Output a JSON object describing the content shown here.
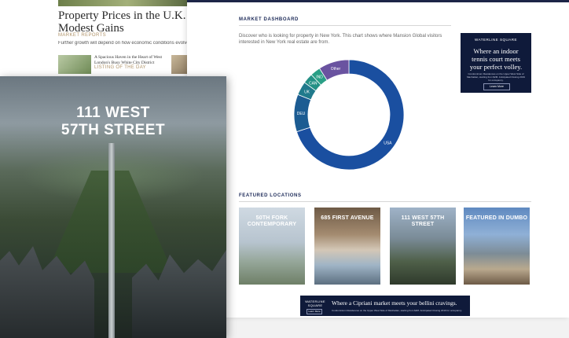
{
  "article": {
    "title_line1": "Property Prices in the U.K. Cont",
    "title_line2": "Modest Gains",
    "tag": "MARKET REPORTS",
    "teaser": "Further growth will depend on how economic conditions evolve,",
    "listing_title": "A Spacious Haven in the Heart of West London's Busy White City District",
    "listing_tag": "LISTING OF THE DAY"
  },
  "dashboard": {
    "heading": "MARKET DASHBOARD",
    "description": "Discover who is looking for property in New York. This chart shows where Mansion Global visitors interested in New York real estate are from."
  },
  "chart_data": {
    "type": "pie",
    "variant": "donut",
    "categories": [
      "USA",
      "DEU",
      "UK",
      "CAN",
      "IND",
      "Other"
    ],
    "values": [
      70,
      11,
      4,
      3,
      3,
      9
    ],
    "colors": [
      "#1a4fa0",
      "#1c5c92",
      "#217a8c",
      "#249085",
      "#2a9f86",
      "#6a53a0"
    ]
  },
  "ad": {
    "brand": "WATERLINE SQUARE",
    "headline": "Where an indoor tennis court meets your perfect volley.",
    "body": "Condominium Residences on the Upper West Side of Manhattan, starting from $2M. Anticipated Closing 2019 for occupancy.",
    "button": "Learn More"
  },
  "featured": {
    "heading": "FEATURED LOCATIONS",
    "cards": [
      {
        "label": "50TH FORK CONTEMPORARY"
      },
      {
        "label": "685 FIRST AVENUE"
      },
      {
        "label": "111 WEST 57TH STREET"
      },
      {
        "label": "FEATURED IN DUMBO"
      }
    ]
  },
  "banner": {
    "brand": "WATERLINE SQUARE",
    "button": "Learn More",
    "headline": "Where a Cipriani market meets your bellini cravings.",
    "body": "Condominium Residences on the Upper West Side of Manhattan, starting from $2M. Anticipated Closing 2019 for occupancy."
  },
  "hero": {
    "line1": "111 WEST",
    "line2": "57TH STREET"
  }
}
